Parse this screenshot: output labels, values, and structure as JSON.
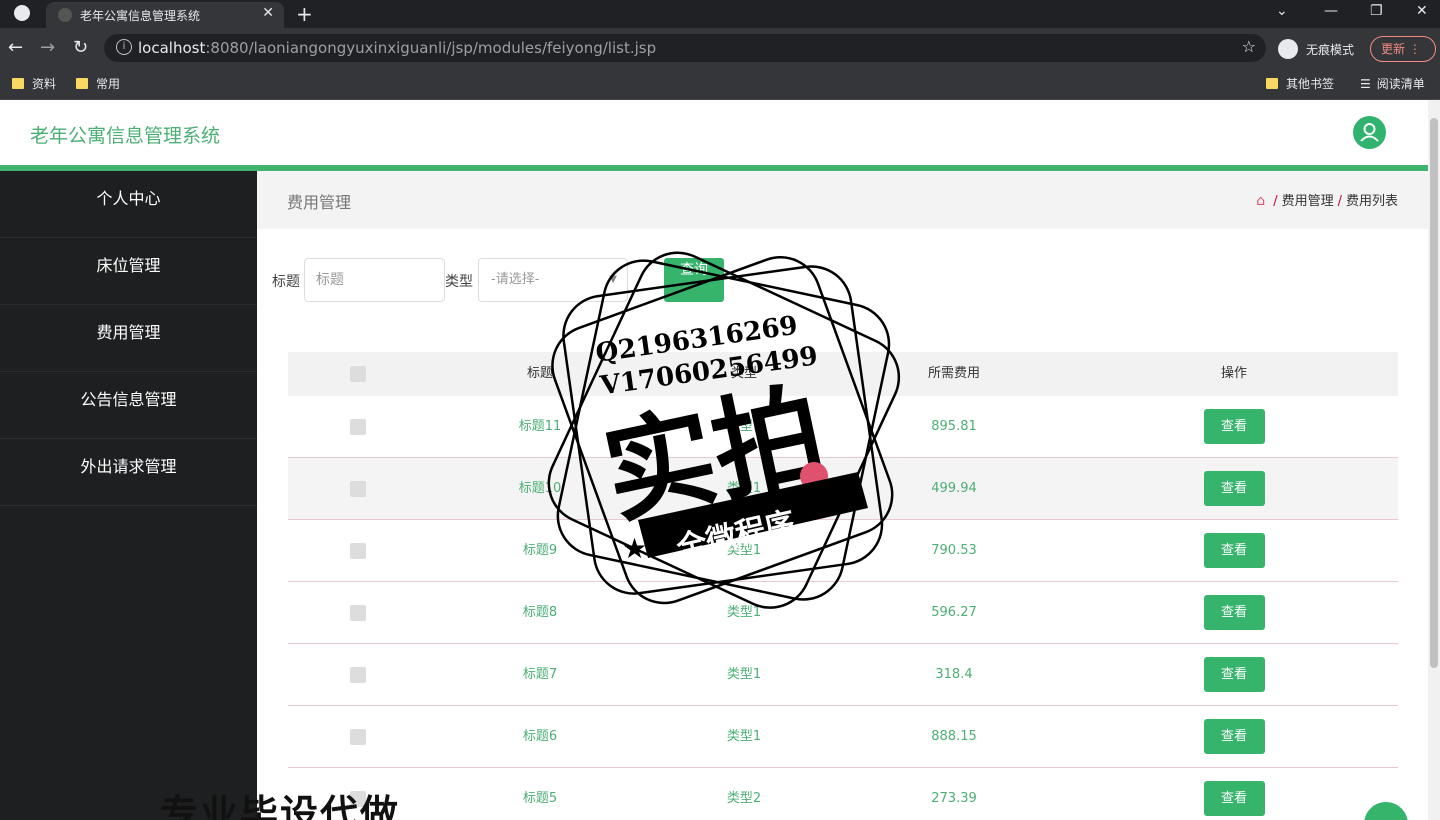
{
  "browser": {
    "tab_title": "老年公寓信息管理系统",
    "url_host": "localhost",
    "url_path": ":8080/laoniangongyuxinxiguanli/jsp/modules/feiyong/list.jsp",
    "incognito_label": "无痕模式",
    "update_label": "更新",
    "bookmarks": [
      "资料",
      "常用"
    ],
    "other_bookmarks": "其他书签",
    "reading_list": "阅读清单"
  },
  "app": {
    "title": "老年公寓信息管理系统"
  },
  "sidebar": {
    "items": [
      {
        "label": "个人中心"
      },
      {
        "label": "床位管理"
      },
      {
        "label": "费用管理"
      },
      {
        "label": "公告信息管理"
      },
      {
        "label": "外出请求管理"
      }
    ]
  },
  "page": {
    "heading": "费用管理",
    "breadcrumb": [
      "费用管理",
      "费用列表"
    ]
  },
  "filters": {
    "title_label": "标题",
    "title_placeholder": "标题",
    "type_label": "类型",
    "type_placeholder": "-请选择-",
    "query_label": "查询"
  },
  "table": {
    "headers": {
      "title": "标题",
      "type": "类型",
      "fee": "所需费用",
      "op": "操作"
    },
    "view_label": "查看",
    "rows": [
      {
        "title": "标题11",
        "type": "类型1",
        "fee": "895.81"
      },
      {
        "title": "标题10",
        "type": "类型1",
        "fee": "499.94"
      },
      {
        "title": "标题9",
        "type": "类型1",
        "fee": "790.53"
      },
      {
        "title": "标题8",
        "type": "类型1",
        "fee": "596.27"
      },
      {
        "title": "标题7",
        "type": "类型1",
        "fee": "318.4"
      },
      {
        "title": "标题6",
        "type": "类型1",
        "fee": "888.15"
      },
      {
        "title": "标题5",
        "type": "类型2",
        "fee": "273.39"
      }
    ]
  },
  "watermark": {
    "line1": "Q2196316269",
    "line2": "V17060256499",
    "big": "实拍",
    "ribbon": "全微程序",
    "bottom": "专业毕设代做"
  },
  "colors": {
    "accent": "#36b46c",
    "sidebar_bg": "#1e1f20"
  }
}
